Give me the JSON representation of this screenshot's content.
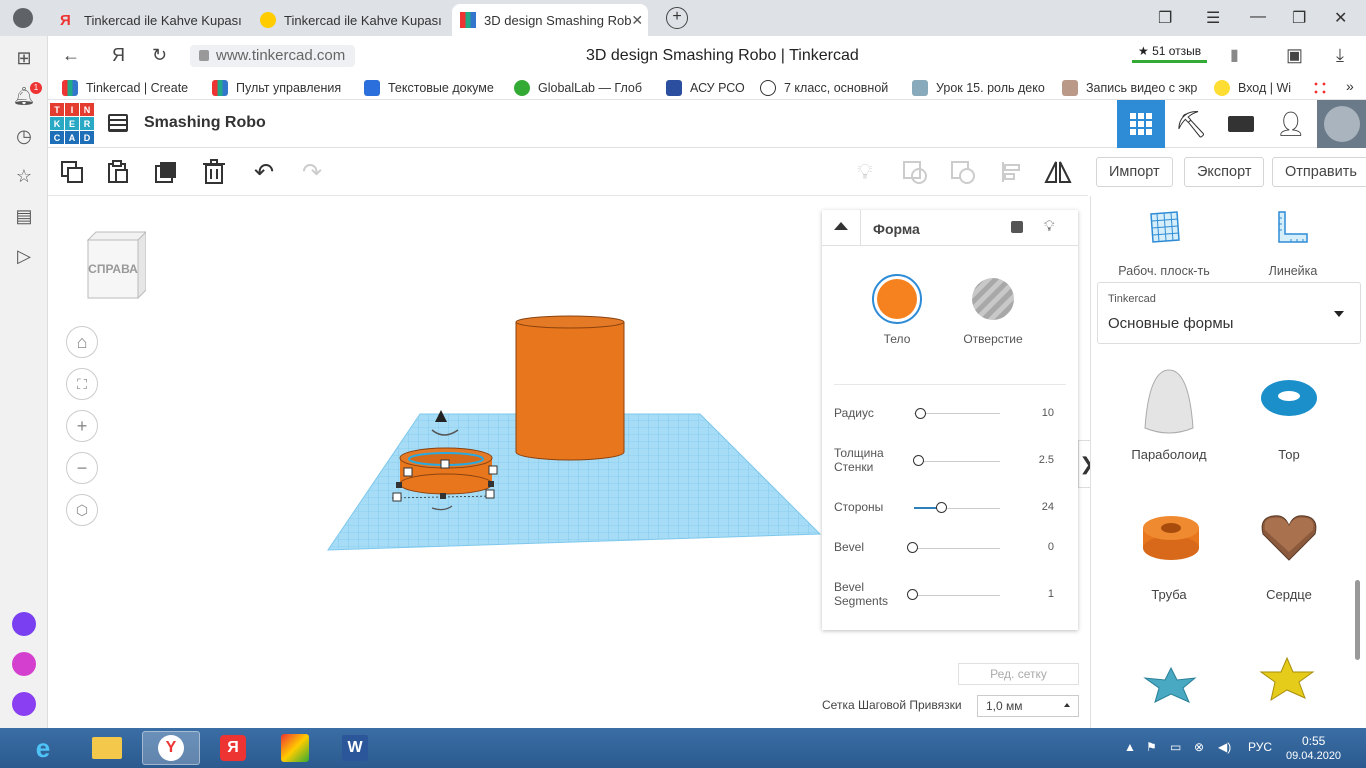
{
  "browser": {
    "tabs": [
      {
        "title": "Tinkercad ile Kahve Kupası"
      },
      {
        "title": "Tinkercad ile Kahve Kupası"
      },
      {
        "title": "3D design Smashing Rob"
      }
    ],
    "url": "www.tinkercad.com",
    "page_title": "3D design Smashing Robo | Tinkercad",
    "reviews": "★ 51 отзыв",
    "notification_count": "1",
    "bookmarks": [
      "Tinkercad | Create",
      "Пульт управления",
      "Текстовые докуме",
      "GlobalLab — Глоб",
      "АСУ РСО",
      "7 класс, основной",
      "Урок 15. роль деко",
      "Запись видео с экр",
      "Вход | Wi"
    ]
  },
  "app": {
    "logo_letters": [
      "T",
      "I",
      "N",
      "K",
      "E",
      "R",
      "C",
      "A",
      "D"
    ],
    "design_name": "Smashing Robo"
  },
  "actions": {
    "import": "Импорт",
    "export": "Экспорт",
    "send": "Отправить"
  },
  "viewcube": {
    "face": "СПРАВА"
  },
  "inspector": {
    "title": "Форма",
    "solid_label": "Тело",
    "hole_label": "Отверстие",
    "solid_color": "#f5821f",
    "props": [
      {
        "label": "Радиус",
        "value": "10"
      },
      {
        "label": "Толщина Стенки",
        "value": "2.5"
      },
      {
        "label": "Стороны",
        "value": "24"
      },
      {
        "label": "Bevel",
        "value": "0"
      },
      {
        "label": "Bevel Segments",
        "value": "1"
      }
    ]
  },
  "right_panel": {
    "workplane": "Рабоч. плоск-ть",
    "ruler": "Линейка",
    "library_source": "Tinkercad",
    "library_name": "Основные формы",
    "shapes": [
      "Параболоид",
      "Тор",
      "Труба",
      "Сердце"
    ]
  },
  "grid": {
    "edit_grid": "Ред. сетку",
    "snap_label": "Сетка Шаговой Привязки",
    "snap_value": "1,0 мм"
  },
  "taskbar": {
    "lang": "РУС",
    "time": "0:55",
    "date": "09.04.2020"
  }
}
